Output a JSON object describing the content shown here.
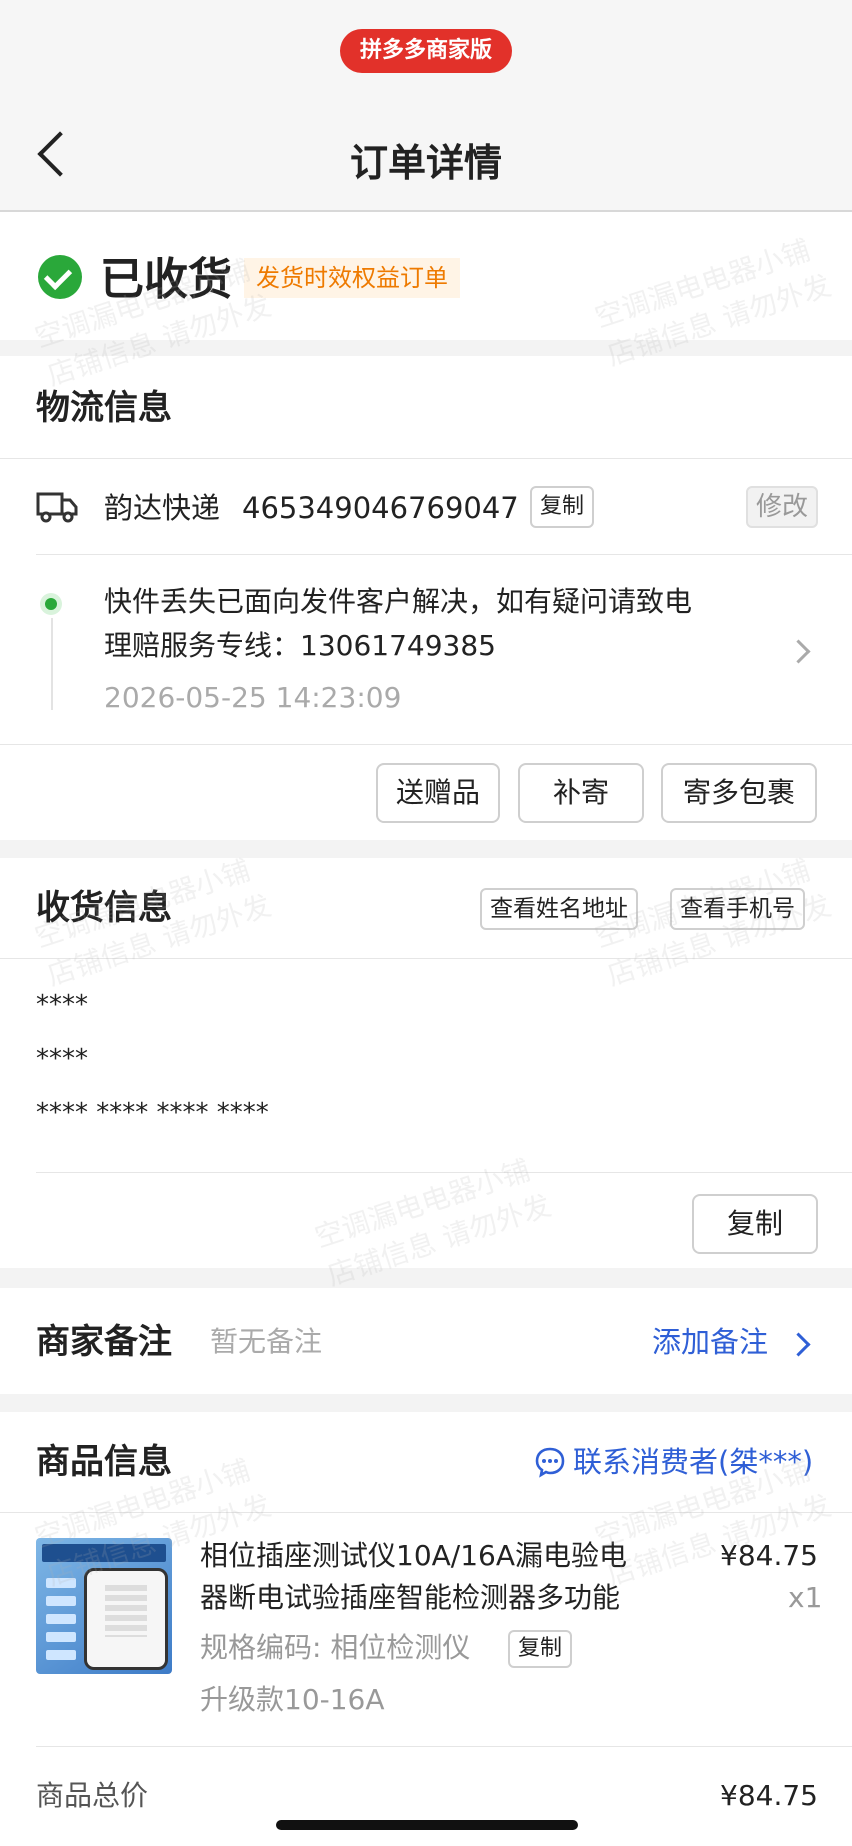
{
  "header": {
    "badge": "拼多多商家版",
    "title": "订单详情"
  },
  "status": {
    "text": "已收货",
    "tag": "发货时效权益订单"
  },
  "logistics": {
    "section_title": "物流信息",
    "carrier": "韵达快递",
    "tracking_no": "465349046769047",
    "copy_label": "复制",
    "modify_label": "修改",
    "event_line1": "快件丢失已面向发件客户解决，如有疑问请致电",
    "event_line2": "理赔服务专线：13061749385",
    "event_time": "2026-05-25 14:23:09",
    "actions": [
      "送赠品",
      "补寄",
      "寄多包裹"
    ]
  },
  "receiver": {
    "section_title": "收货信息",
    "view_name_address": "查看姓名地址",
    "view_phone": "查看手机号",
    "name": "****",
    "phone": "****",
    "address": "**** **** **** ****",
    "copy_label": "复制"
  },
  "merchant_note": {
    "label": "商家备注",
    "value": "暂无备注",
    "action": "添加备注"
  },
  "product": {
    "section_title": "商品信息",
    "contact": "联系消费者(桀***)",
    "name_line1": "相位插座测试仪10A/16A漏电验电",
    "name_line2": "器断电试验插座智能检测器多功能",
    "spec_code": "规格编码: 相位检测仪",
    "copy_label": "复制",
    "variant": "升级款10-16A",
    "price": "¥84.75",
    "qty": "x1"
  },
  "summary": {
    "total_label": "商品总价",
    "total_value": "¥84.75"
  },
  "watermark": {
    "line1": "空调漏电电器小铺",
    "line2": "店铺信息 请勿外发"
  }
}
